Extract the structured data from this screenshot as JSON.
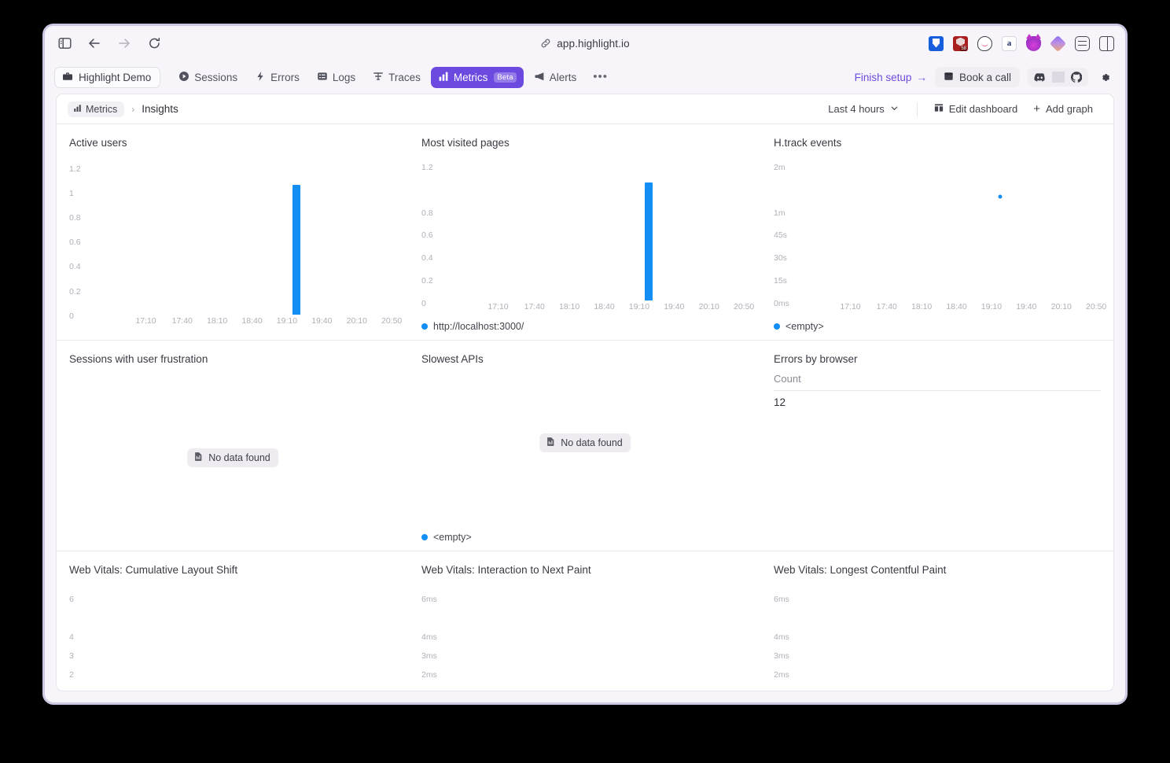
{
  "browser": {
    "url": "app.highlight.io",
    "nav": {
      "sidebar_toggle": "sidebar-toggle-icon",
      "back": "back-arrow-icon",
      "forward": "forward-arrow-icon",
      "reload": "reload-icon"
    },
    "extensions": [
      {
        "name": "bitwarden-extension-icon"
      },
      {
        "name": "ublock-origin-extension-icon",
        "badge": "58"
      },
      {
        "name": "speech-bubble-extension-icon"
      },
      {
        "name": "letter-a-extension-icon",
        "glyph": "a"
      },
      {
        "name": "cat-extension-icon"
      },
      {
        "name": "diamond-extension-icon"
      },
      {
        "name": "settings-sliders-extension-icon"
      },
      {
        "name": "browser-panel-toggle-icon"
      }
    ]
  },
  "app_header": {
    "project": "Highlight Demo",
    "tabs": [
      {
        "label": "Sessions",
        "icon": "play-circle-icon",
        "active": false
      },
      {
        "label": "Errors",
        "icon": "bolt-icon",
        "active": false
      },
      {
        "label": "Logs",
        "icon": "logs-icon",
        "active": false
      },
      {
        "label": "Traces",
        "icon": "traces-icon",
        "active": false
      },
      {
        "label": "Metrics",
        "icon": "bar-chart-icon",
        "active": true,
        "badge": "Beta"
      },
      {
        "label": "Alerts",
        "icon": "megaphone-icon",
        "active": false
      }
    ],
    "overflow_label": "•••",
    "finish_setup": "Finish setup",
    "finish_setup_arrow": "→",
    "book_a_call": "Book a call",
    "discord": "discord-icon",
    "github": "github-icon",
    "settings": "gear-icon"
  },
  "dashboard": {
    "breadcrumb_root": "Metrics",
    "breadcrumb_sep": "›",
    "breadcrumb_current": "Insights",
    "time_range": "Last 4 hours",
    "edit_dashboard": "Edit dashboard",
    "add_graph": "Add graph",
    "add_graph_plus": "+",
    "no_data_label": "No data found"
  },
  "colors": {
    "accent_purple": "#6c4ae0",
    "series_blue": "#128ef4",
    "axis_gray": "#b0aeb8"
  },
  "chart_data": [
    {
      "id": "active-users",
      "type": "bar",
      "title": "Active users",
      "yticks": [
        "0",
        "0.2",
        "0.4",
        "0.6",
        "0.8",
        "1",
        "1.2"
      ],
      "ylim": [
        0,
        1.2
      ],
      "xticks": [
        "17:10",
        "17:40",
        "18:10",
        "18:40",
        "19:10",
        "19:40",
        "20:10",
        "20:50"
      ],
      "series": [
        {
          "name": "",
          "points": [
            {
              "x": "19:20",
              "xpct": 65.5,
              "value": 1
            }
          ]
        }
      ],
      "legend": null
    },
    {
      "id": "most-visited-pages",
      "type": "bar",
      "title": "Most visited pages",
      "yticks": [
        "0",
        "0.2",
        "0.4",
        "0.6",
        "0.8",
        "1.2"
      ],
      "ylim": [
        0,
        1.2
      ],
      "xticks": [
        "17:10",
        "17:40",
        "18:10",
        "18:40",
        "19:10",
        "19:40",
        "20:10",
        "20:50"
      ],
      "series": [
        {
          "name": "http://localhost:3000/",
          "points": [
            {
              "x": "19:20",
              "xpct": 65.5,
              "value": 1
            }
          ]
        }
      ],
      "legend": "http://localhost:3000/"
    },
    {
      "id": "h-track-events",
      "type": "scatter",
      "title": "H.track events",
      "yticks": [
        "0ms",
        "15s",
        "30s",
        "45s",
        "1m",
        "2m"
      ],
      "ylim": [
        0,
        120
      ],
      "xticks": [
        "17:10",
        "17:40",
        "18:10",
        "18:40",
        "19:10",
        "19:40",
        "20:10",
        "20:50"
      ],
      "series": [
        {
          "name": "<empty>",
          "points": [
            {
              "x": "19:20",
              "xpct": 65.5,
              "value": 62
            }
          ]
        }
      ],
      "legend": "<empty>"
    },
    {
      "id": "sessions-with-user-frustration",
      "type": "bar",
      "title": "Sessions with user frustration",
      "empty": true,
      "empty_message": "No data found",
      "legend": null
    },
    {
      "id": "slowest-apis",
      "type": "bar",
      "title": "Slowest APIs",
      "empty": true,
      "empty_message": "No data found",
      "legend": "<empty>"
    },
    {
      "id": "errors-by-browser",
      "type": "table",
      "title": "Errors by browser",
      "columns": [
        "Count"
      ],
      "rows": [
        [
          "12"
        ]
      ]
    },
    {
      "id": "web-vitals-cls",
      "type": "bar",
      "title": "Web Vitals: Cumulative Layout Shift",
      "yticks": [
        "2",
        "3",
        "4",
        "6"
      ],
      "ylim": [
        0,
        6
      ],
      "series": []
    },
    {
      "id": "web-vitals-inp",
      "type": "bar",
      "title": "Web Vitals: Interaction to Next Paint",
      "yticks": [
        "2ms",
        "3ms",
        "4ms",
        "6ms"
      ],
      "ylim": [
        0,
        6
      ],
      "series": []
    },
    {
      "id": "web-vitals-lcp",
      "type": "bar",
      "title": "Web Vitals: Longest Contentful Paint",
      "yticks": [
        "2ms",
        "3ms",
        "4ms",
        "6ms"
      ],
      "ylim": [
        0,
        6
      ],
      "series": []
    }
  ]
}
